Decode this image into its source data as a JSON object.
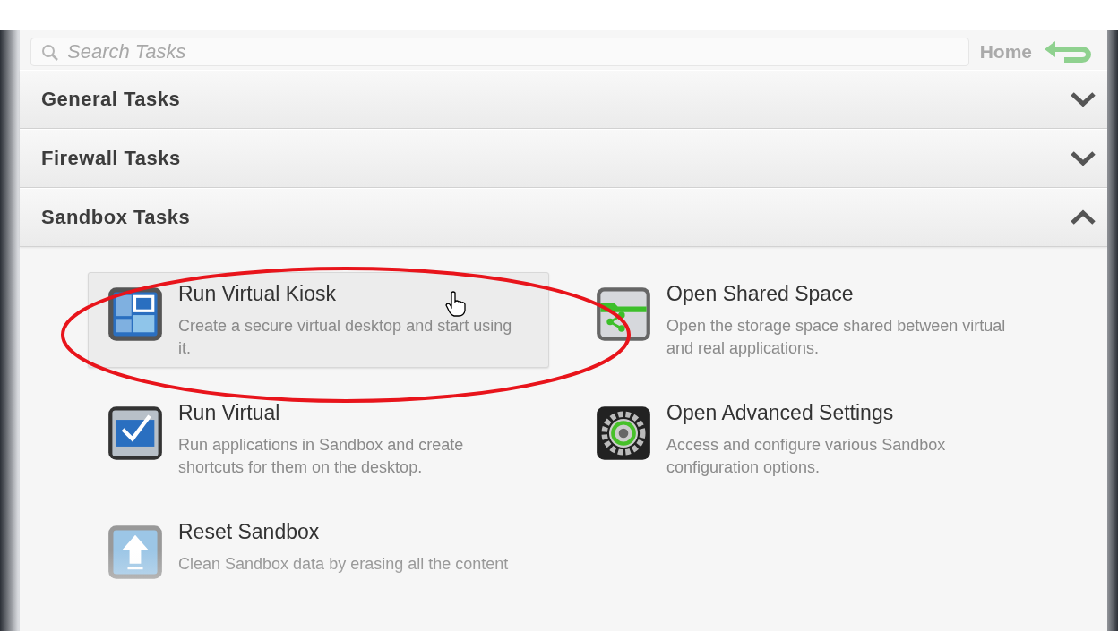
{
  "search": {
    "placeholder": "Search Tasks"
  },
  "home": {
    "label": "Home"
  },
  "sections": [
    {
      "title": "General Tasks",
      "expanded": false
    },
    {
      "title": "Firewall Tasks",
      "expanded": false
    },
    {
      "title": "Sandbox Tasks",
      "expanded": true,
      "tasks": [
        {
          "title": "Run Virtual Kiosk",
          "description": "Create a secure virtual desktop and start using it.",
          "kind": "kiosk",
          "selected": true
        },
        {
          "title": "Open Shared Space",
          "description": "Open the storage space shared between virtual and real applications.",
          "kind": "share",
          "selected": false
        },
        {
          "title": "Run Virtual",
          "description": "Run applications in Sandbox and create shortcuts for them on the desktop.",
          "kind": "check",
          "selected": false
        },
        {
          "title": "Open Advanced Settings",
          "description": "Access and configure various Sandbox configuration options.",
          "kind": "gear",
          "selected": false
        },
        {
          "title": "Reset Sandbox",
          "description": "Clean Sandbox data by erasing all the content",
          "kind": "reset",
          "selected": false
        }
      ]
    }
  ]
}
